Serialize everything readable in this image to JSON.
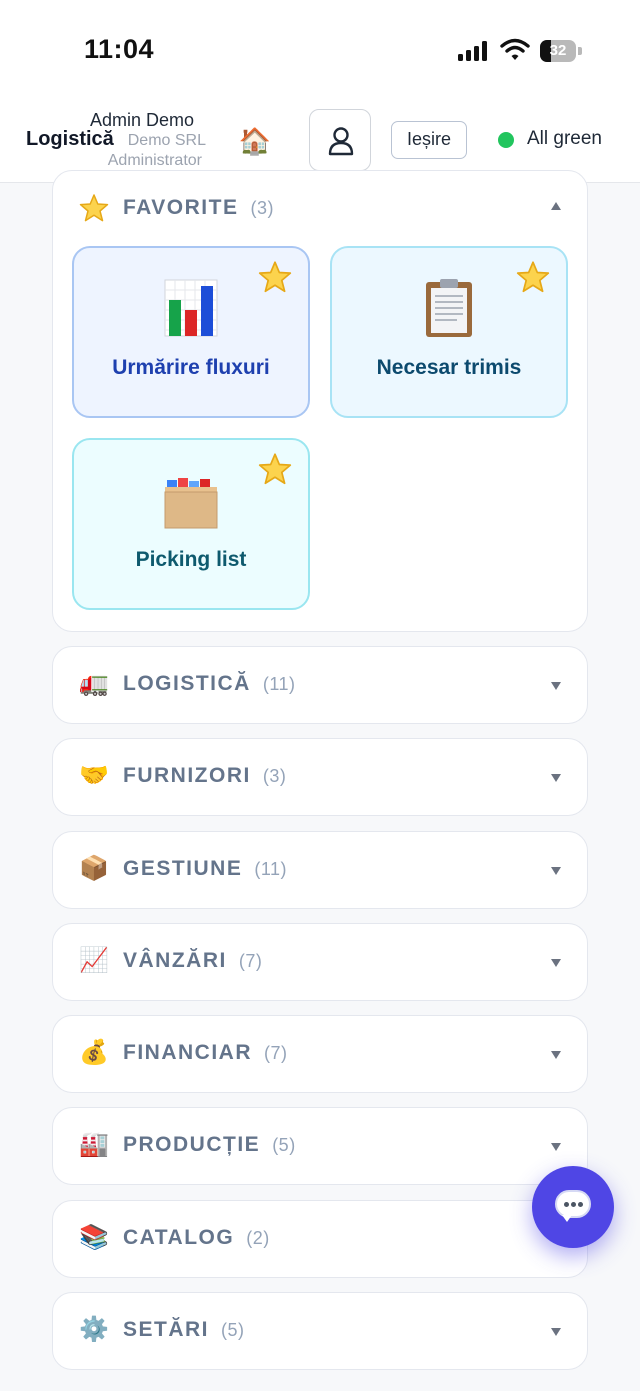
{
  "status_bar": {
    "time": "11:04",
    "battery": "32"
  },
  "header": {
    "user_name": "Admin Demo",
    "company": "Demo SRL",
    "title": "Logistică",
    "role": "Administrator",
    "exit_label": "Ieșire",
    "status_text": "All green",
    "status_color": "#22c55e"
  },
  "sections": [
    {
      "icon": "star-icon",
      "label": "FAVORITE",
      "count": "(3)",
      "expanded": true
    },
    {
      "icon": "truck-icon",
      "label": "LOGISTICĂ",
      "count": "(11)"
    },
    {
      "icon": "handshake-icon",
      "label": "FURNIZORI",
      "count": "(3)"
    },
    {
      "icon": "package-icon",
      "label": "GESTIUNE",
      "count": "(11)"
    },
    {
      "icon": "chart-up-icon",
      "label": "VÂNZĂRI",
      "count": "(7)"
    },
    {
      "icon": "money-bag-icon",
      "label": "FINANCIAR",
      "count": "(7)"
    },
    {
      "icon": "factory-icon",
      "label": "PRODUCȚIE",
      "count": "(5)"
    },
    {
      "icon": "books-icon",
      "label": "CATALOG",
      "count": "(2)"
    },
    {
      "icon": "gear-icon",
      "label": "SETĂRI",
      "count": "(5)"
    }
  ],
  "favorites": [
    {
      "label": "Urmărire fluxuri",
      "icon": "bar-chart-icon",
      "color": "#1e40af"
    },
    {
      "label": "Necesar trimis",
      "icon": "clipboard-icon",
      "color": "#0c4a6e"
    },
    {
      "label": "Picking list",
      "icon": "card-index-icon",
      "color": "#0e5a6e"
    }
  ],
  "chat": {
    "icon": "chat-bubble-icon"
  }
}
